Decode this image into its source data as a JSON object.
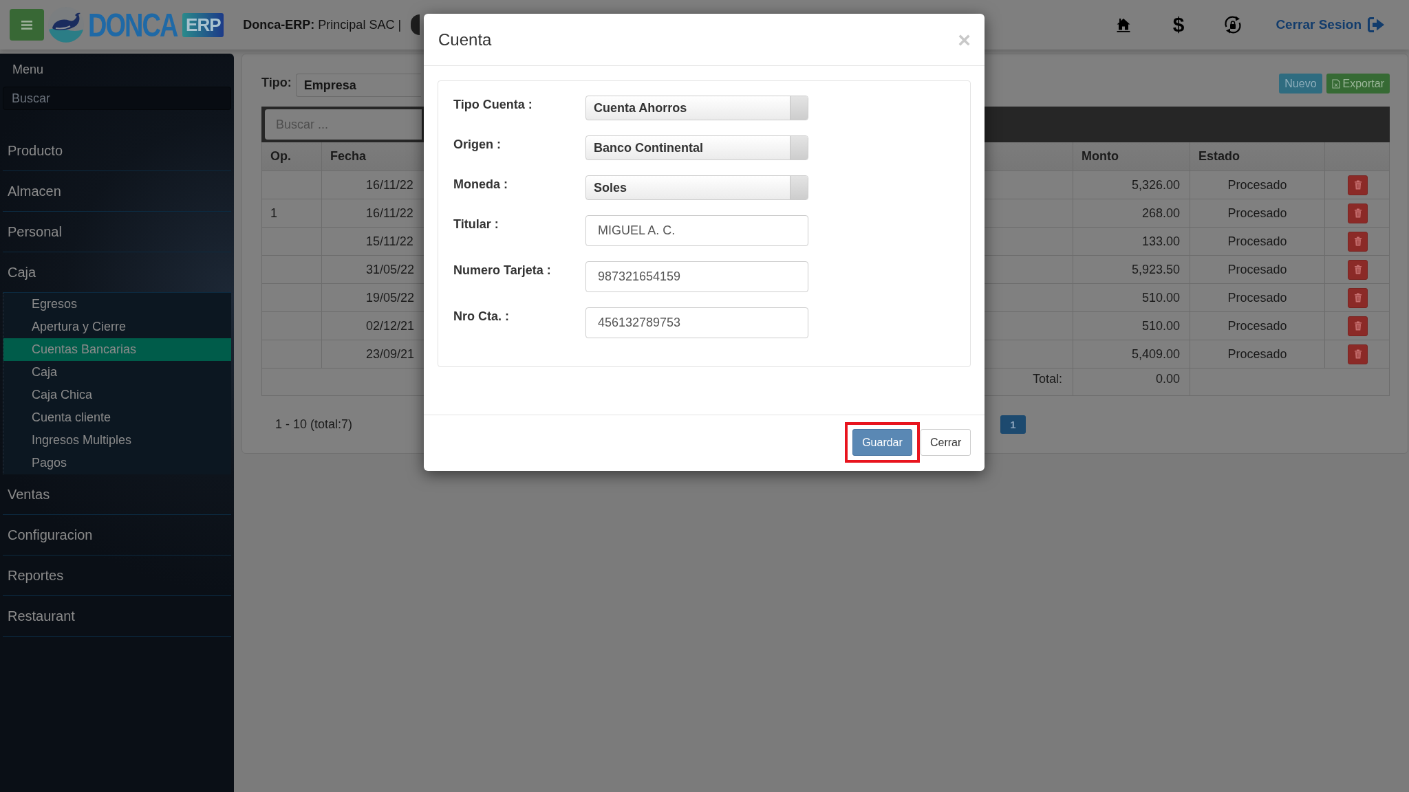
{
  "header": {
    "brand": {
      "name": "DONCA",
      "badge": "ERP"
    },
    "company": "**Donca-ERP:** Principal SAC |",
    "currency_symbol": "$",
    "logout": "Cerrar Sesion"
  },
  "sidebar": {
    "title": "Menu",
    "search": {
      "placeholder": "Buscar"
    },
    "items": [
      {
        "label": "Producto",
        "selected": false
      },
      {
        "label": "Almacen",
        "selected": false
      },
      {
        "label": "Personal",
        "selected": false
      },
      {
        "label": "Caja",
        "selected": false,
        "children": [
          {
            "label": "Egresos",
            "selected": false
          },
          {
            "label": "Apertura y Cierre",
            "selected": false
          },
          {
            "label": "Cuentas Bancarias",
            "selected": true
          },
          {
            "label": "Caja",
            "selected": false
          },
          {
            "label": "Caja Chica",
            "selected": false
          },
          {
            "label": "Cuenta cliente",
            "selected": false
          },
          {
            "label": "Ingresos Multiples",
            "selected": false
          },
          {
            "label": "Pagos",
            "selected": false
          }
        ]
      },
      {
        "label": "Ventas",
        "selected": false
      },
      {
        "label": "Configuracion",
        "selected": false
      },
      {
        "label": "Reportes",
        "selected": false
      },
      {
        "label": "Restaurant",
        "selected": false
      }
    ]
  },
  "content": {
    "filter": {
      "label": "Tipo:",
      "value": "Empresa"
    },
    "actions": [
      {
        "label": "Nuevo",
        "kind": "new"
      },
      {
        "label": "Exportar",
        "kind": "export"
      }
    ],
    "search": {
      "placeholder": "Buscar ..."
    },
    "table": {
      "columns": [
        "Op.",
        "Fecha",
        "Monto",
        "Estado"
      ],
      "rows": [
        {
          "fecha": "16/11/22",
          "monto": "5,326.00",
          "estado": "Procesado"
        },
        {
          "op": "1",
          "fecha": "16/11/22",
          "monto": "268.00",
          "estado": "Procesado"
        },
        {
          "fecha": "15/11/22",
          "monto": "133.00",
          "estado": "Procesado"
        },
        {
          "fecha": "31/05/22",
          "monto": "5,923.50",
          "estado": "Procesado"
        },
        {
          "fecha": "19/05/22",
          "monto": "510.00",
          "estado": "Procesado"
        },
        {
          "fecha": "02/12/21",
          "monto": "510.00",
          "estado": "Procesado"
        },
        {
          "fecha": "23/09/21",
          "monto": "5,409.00",
          "estado": "Procesado"
        }
      ],
      "total_label": "Total:",
      "total": "0.00"
    },
    "pagination": {
      "summary": "1 - 10 (total:7)",
      "pages": [
        {
          "label": "1",
          "selected": true
        }
      ]
    }
  },
  "modal": {
    "title": "Cuenta",
    "close": "×",
    "fields": [
      {
        "label": "Tipo Cuenta :",
        "kind": "select",
        "value": "Cuenta Ahorros"
      },
      {
        "label": "Origen :",
        "kind": "select",
        "value": "Banco Continental"
      },
      {
        "label": "Moneda :",
        "kind": "select",
        "value": "Soles"
      },
      {
        "label": "Titular :",
        "kind": "text",
        "value": "MIGUEL A. C."
      },
      {
        "label": "Numero Tarjeta :",
        "kind": "text",
        "value": "987321654159"
      },
      {
        "label": "Nro Cta. :",
        "kind": "text",
        "value": "456132789753"
      }
    ],
    "buttons": [
      {
        "label": "Guardar",
        "kind": "primary",
        "highlighted": true
      },
      {
        "label": "Cerrar",
        "kind": "default",
        "highlighted": false
      }
    ]
  }
}
